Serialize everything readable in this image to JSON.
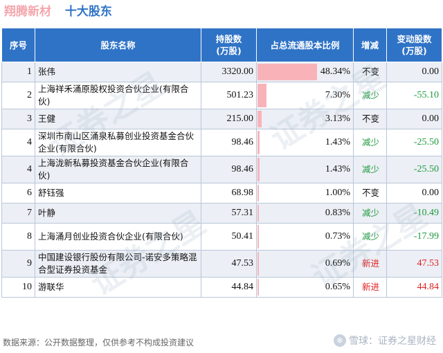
{
  "title": {
    "company": "翔腾新材",
    "subtitle": "十大股东"
  },
  "columns": {
    "rank": "序号",
    "name": "股东名称",
    "shares": [
      "持股数",
      "(万股)"
    ],
    "ratio": "占总流通股本比例",
    "change": "增减",
    "delta": [
      "变动股数",
      "(万股)"
    ]
  },
  "rows": [
    {
      "rank": "1",
      "name": "张伟",
      "shares": "3320.00",
      "ratio": "48.34%",
      "ratio_value": 48.34,
      "change": "不变",
      "change_type": "same",
      "delta": "0.00"
    },
    {
      "rank": "2",
      "name": "上海祥禾涌原股权投资合伙企业(有限合伙)",
      "shares": "501.23",
      "ratio": "7.30%",
      "ratio_value": 7.3,
      "change": "减少",
      "change_type": "down",
      "delta": "-55.10"
    },
    {
      "rank": "3",
      "name": "王健",
      "shares": "215.00",
      "ratio": "3.13%",
      "ratio_value": 3.13,
      "change": "不变",
      "change_type": "same",
      "delta": "0.00"
    },
    {
      "rank": "4",
      "name": "深圳市南山区涌泉私募创业投资基金合伙企业(有限合伙)",
      "shares": "98.46",
      "ratio": "1.43%",
      "ratio_value": 1.43,
      "change": "减少",
      "change_type": "down",
      "delta": "-25.50"
    },
    {
      "rank": "4",
      "name": "上海泷新私募投资基金合伙企业(有限合伙)",
      "shares": "98.46",
      "ratio": "1.43%",
      "ratio_value": 1.43,
      "change": "减少",
      "change_type": "down",
      "delta": "-25.50"
    },
    {
      "rank": "6",
      "name": "舒钰强",
      "shares": "68.98",
      "ratio": "1.00%",
      "ratio_value": 1.0,
      "change": "不变",
      "change_type": "same",
      "delta": "0.00"
    },
    {
      "rank": "7",
      "name": "叶静",
      "shares": "57.31",
      "ratio": "0.83%",
      "ratio_value": 0.83,
      "change": "减少",
      "change_type": "down",
      "delta": "-10.49"
    },
    {
      "rank": "8",
      "name": "上海涌月创业投资合伙企业(有限合伙)",
      "shares": "50.41",
      "ratio": "0.73%",
      "ratio_value": 0.73,
      "change": "减少",
      "change_type": "down",
      "delta": "-17.99"
    },
    {
      "rank": "9",
      "name": "中国建设银行股份有限公司-诺安多策略混合型证券投资基金",
      "shares": "47.53",
      "ratio": "0.69%",
      "ratio_value": 0.69,
      "change": "新进",
      "change_type": "new",
      "delta": "47.53"
    },
    {
      "rank": "10",
      "name": "游联华",
      "shares": "44.84",
      "ratio": "0.65%",
      "ratio_value": 0.65,
      "change": "新进",
      "change_type": "new",
      "delta": "44.84"
    }
  ],
  "watermark": "证券之星",
  "footer": {
    "source": "数据来源：公开数据整理，仅供参考不构成投资建议",
    "brand": "雪球：证券之星财经",
    "brand_icon": "snowball-icon"
  },
  "colors": {
    "header": "#2f73c6",
    "bar": "#f8b3b9",
    "down": "#1f9a3e",
    "new": "#e02020",
    "company": "#f4a7ae"
  }
}
